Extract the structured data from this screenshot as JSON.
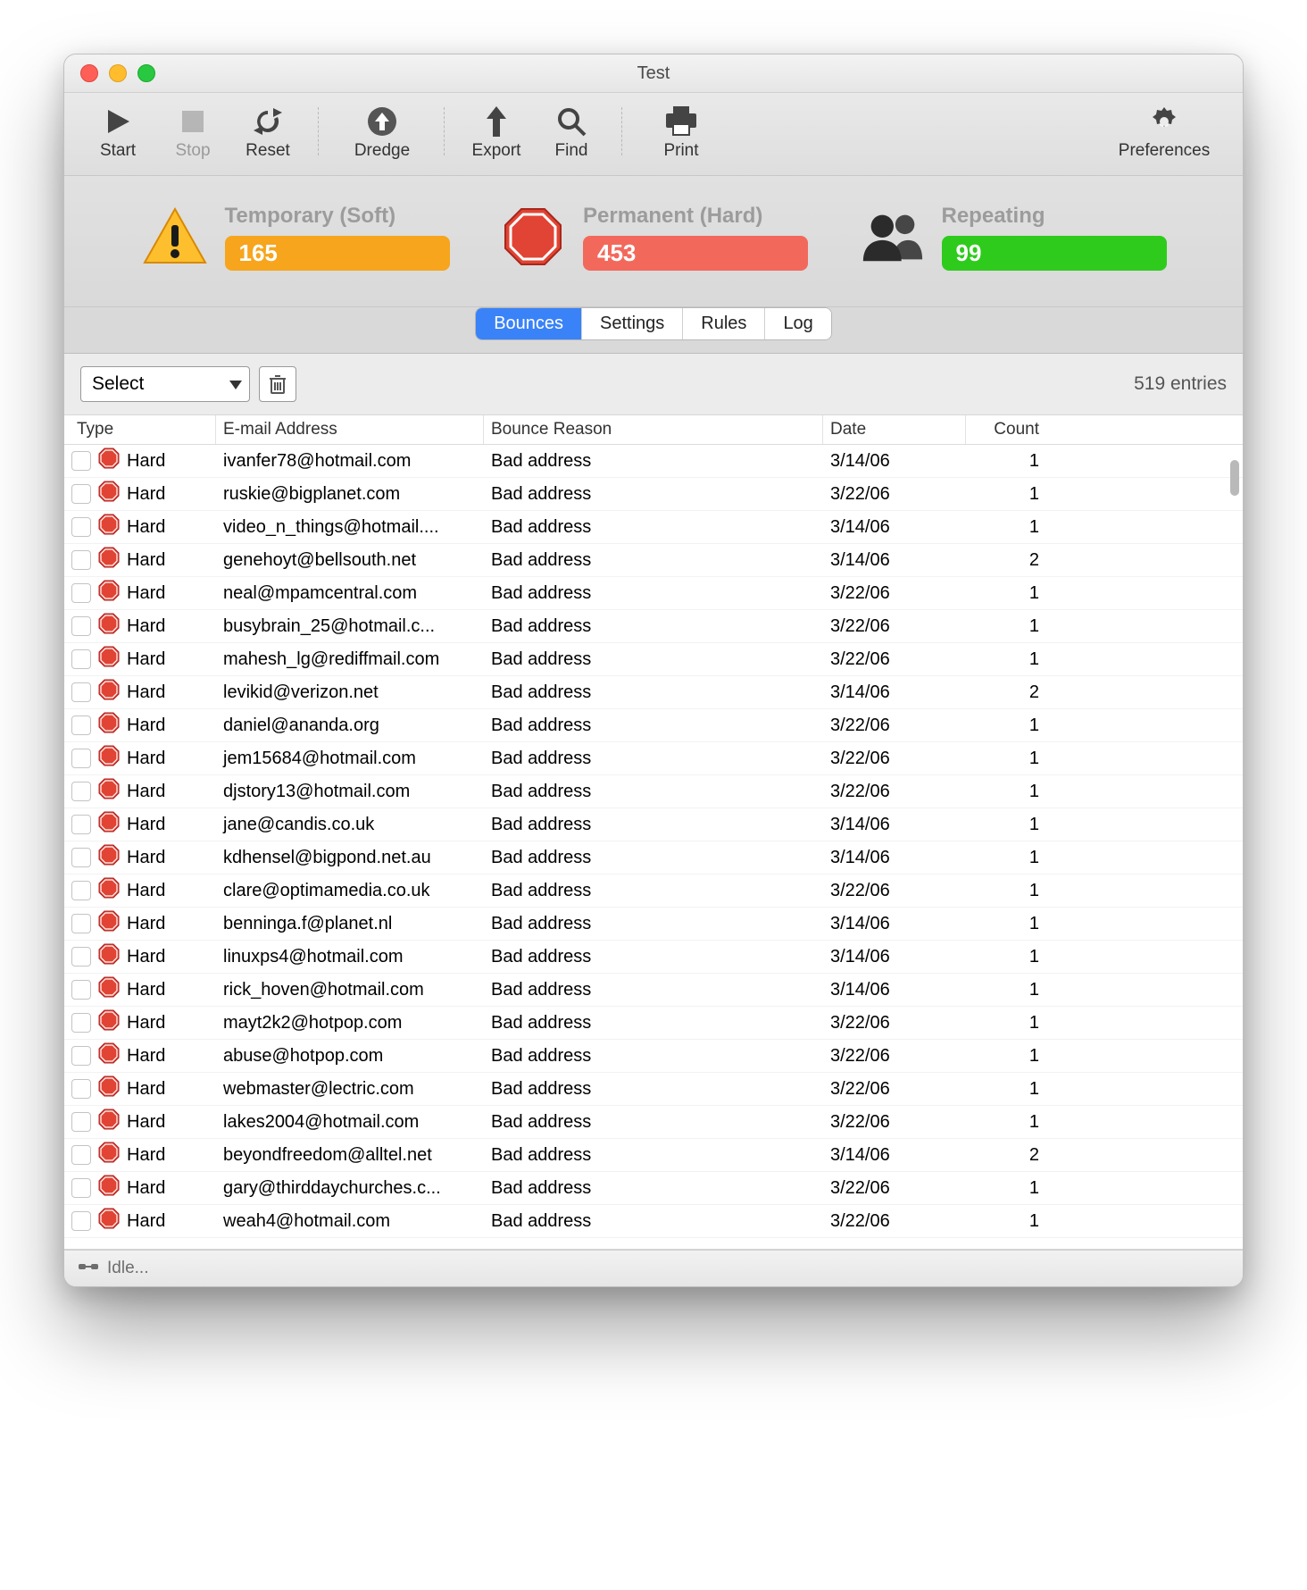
{
  "window": {
    "title": "Test"
  },
  "toolbar": {
    "start": "Start",
    "stop": "Stop",
    "reset": "Reset",
    "dredge": "Dredge",
    "export": "Export",
    "find": "Find",
    "print": "Print",
    "preferences": "Preferences"
  },
  "stats": {
    "soft": {
      "label": "Temporary (Soft)",
      "value": "165"
    },
    "hard": {
      "label": "Permanent (Hard)",
      "value": "453"
    },
    "repeat": {
      "label": "Repeating",
      "value": "99"
    }
  },
  "segments": {
    "bounces": "Bounces",
    "settings": "Settings",
    "rules": "Rules",
    "log": "Log"
  },
  "controls": {
    "select": "Select",
    "entries": "519 entries"
  },
  "columns": {
    "type": "Type",
    "email": "E-mail Address",
    "reason": "Bounce Reason",
    "date": "Date",
    "count": "Count"
  },
  "rows": [
    {
      "type": "Hard",
      "email": "ivanfer78@hotmail.com",
      "reason": "Bad address",
      "date": "3/14/06",
      "count": "1"
    },
    {
      "type": "Hard",
      "email": "ruskie@bigplanet.com",
      "reason": "Bad address",
      "date": "3/22/06",
      "count": "1"
    },
    {
      "type": "Hard",
      "email": "video_n_things@hotmail....",
      "reason": "Bad address",
      "date": "3/14/06",
      "count": "1"
    },
    {
      "type": "Hard",
      "email": "genehoyt@bellsouth.net",
      "reason": "Bad address",
      "date": "3/14/06",
      "count": "2"
    },
    {
      "type": "Hard",
      "email": "neal@mpamcentral.com",
      "reason": "Bad address",
      "date": "3/22/06",
      "count": "1"
    },
    {
      "type": "Hard",
      "email": "busybrain_25@hotmail.c...",
      "reason": "Bad address",
      "date": "3/22/06",
      "count": "1"
    },
    {
      "type": "Hard",
      "email": "mahesh_lg@rediffmail.com",
      "reason": "Bad address",
      "date": "3/22/06",
      "count": "1"
    },
    {
      "type": "Hard",
      "email": "levikid@verizon.net",
      "reason": "Bad address",
      "date": "3/14/06",
      "count": "2"
    },
    {
      "type": "Hard",
      "email": "daniel@ananda.org",
      "reason": "Bad address",
      "date": "3/22/06",
      "count": "1"
    },
    {
      "type": "Hard",
      "email": "jem15684@hotmail.com",
      "reason": "Bad address",
      "date": "3/22/06",
      "count": "1"
    },
    {
      "type": "Hard",
      "email": "djstory13@hotmail.com",
      "reason": "Bad address",
      "date": "3/22/06",
      "count": "1"
    },
    {
      "type": "Hard",
      "email": "jane@candis.co.uk",
      "reason": "Bad address",
      "date": "3/14/06",
      "count": "1"
    },
    {
      "type": "Hard",
      "email": "kdhensel@bigpond.net.au",
      "reason": "Bad address",
      "date": "3/14/06",
      "count": "1"
    },
    {
      "type": "Hard",
      "email": "clare@optimamedia.co.uk",
      "reason": "Bad address",
      "date": "3/22/06",
      "count": "1"
    },
    {
      "type": "Hard",
      "email": "benninga.f@planet.nl",
      "reason": "Bad address",
      "date": "3/14/06",
      "count": "1"
    },
    {
      "type": "Hard",
      "email": "linuxps4@hotmail.com",
      "reason": "Bad address",
      "date": "3/14/06",
      "count": "1"
    },
    {
      "type": "Hard",
      "email": "rick_hoven@hotmail.com",
      "reason": "Bad address",
      "date": "3/14/06",
      "count": "1"
    },
    {
      "type": "Hard",
      "email": "mayt2k2@hotpop.com",
      "reason": "Bad address",
      "date": "3/22/06",
      "count": "1"
    },
    {
      "type": "Hard",
      "email": "abuse@hotpop.com",
      "reason": "Bad address",
      "date": "3/22/06",
      "count": "1"
    },
    {
      "type": "Hard",
      "email": "webmaster@lectric.com",
      "reason": "Bad address",
      "date": "3/22/06",
      "count": "1"
    },
    {
      "type": "Hard",
      "email": "lakes2004@hotmail.com",
      "reason": "Bad address",
      "date": "3/22/06",
      "count": "1"
    },
    {
      "type": "Hard",
      "email": "beyondfreedom@alltel.net",
      "reason": "Bad address",
      "date": "3/14/06",
      "count": "2"
    },
    {
      "type": "Hard",
      "email": "gary@thirddaychurches.c...",
      "reason": "Bad address",
      "date": "3/22/06",
      "count": "1"
    },
    {
      "type": "Hard",
      "email": "weah4@hotmail.com",
      "reason": "Bad address",
      "date": "3/22/06",
      "count": "1"
    }
  ],
  "status": {
    "text": "Idle..."
  }
}
